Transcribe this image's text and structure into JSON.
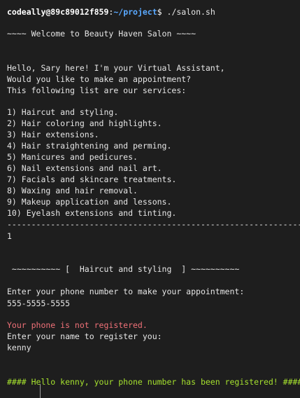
{
  "prompt": {
    "user_host": "codeally@89c89012f859",
    "separator": ":",
    "path": "~/project",
    "dollar": "$",
    "command": "./salon.sh"
  },
  "welcome": "~~~~ Welcome to Beauty Haven Salon ~~~~",
  "intro": [
    "Hello, Sary here! I'm your Virtual Assistant,",
    "Would you like to make an appointment?",
    "This following list are our services:"
  ],
  "services": [
    "1) Haircut and styling.",
    "2) Hair coloring and highlights.",
    "3) Hair extensions.",
    "4) Hair straightening and perming.",
    "5) Manicures and pedicures.",
    "6) Nail extensions and nail art.",
    "7) Facials and skincare treatments.",
    "8) Waxing and hair removal.",
    "9) Makeup application and lessons.",
    "10) Eyelash extensions and tinting."
  ],
  "divider": "----------------------------------------------------------------",
  "selection": "1",
  "service_header": " ~~~~~~~~~~ [  Haircut and styling  ] ~~~~~~~~~~",
  "phone_prompt": "Enter your phone number to make your appointment:",
  "phone_value": "555-5555-5555",
  "not_registered": "Your phone is not registered.",
  "name_prompt": "Enter your name to register you:",
  "name_value": "kenny",
  "registered_msg": "#### Hello kenny, your phone number has been registered! ####",
  "colors": {
    "background": "#1e1e1e",
    "text": "#e6e6e6",
    "path": "#5aa9ff",
    "error": "#f07178",
    "success": "#a6e22e"
  }
}
